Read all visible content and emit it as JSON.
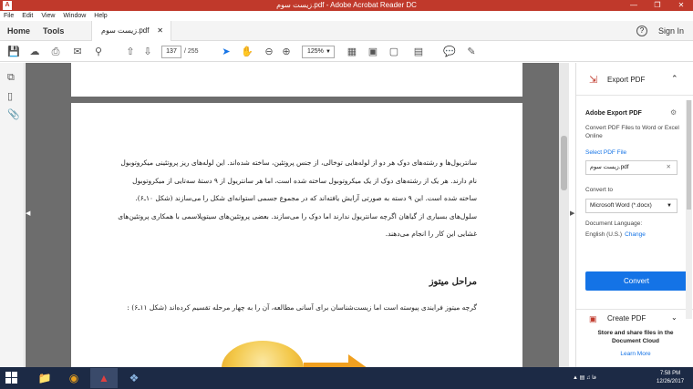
{
  "window": {
    "title": "زیست سوم.pdf - Adobe Acrobat Reader DC",
    "app_icon": "pdf-icon",
    "minimize": "—",
    "maximize": "❐",
    "close": "✕"
  },
  "menu": [
    "File",
    "Edit",
    "View",
    "Window",
    "Help"
  ],
  "tabs": {
    "home": "Home",
    "tools": "Tools",
    "doc_tab": "زیست سوم.pdf",
    "doc_tab_close": "✕",
    "help": "?",
    "sign_in": "Sign In"
  },
  "toolbar": {
    "page_current": "137",
    "page_total": "/ 255",
    "zoom": "125%",
    "icons": [
      "save-icon",
      "cloud-upload-icon",
      "print-icon",
      "email-icon",
      "search-icon",
      "prev-page-icon",
      "next-page-icon",
      "select-cursor-icon",
      "hand-icon",
      "zoom-out-icon",
      "zoom-in-icon",
      "fit-page-icon",
      "full-screen-icon",
      "rotate-icon",
      "scroll-mode-icon",
      "comment-icon",
      "sign-icon"
    ]
  },
  "document": {
    "paragraph1": "سانتریول‌ها و رشته‌های دوک هر دو از لوله‌هایی توخالی، از جنس پروتئین، ساخته شده‌اند. این لوله‌های ریز پروتئینی میکروتوبول نام دارند. هر یک از رشته‌های دوک از یک میکروتوبول ساخته شده است، اما هر سانتریول از ۹ دستهٔ سه‌تایی از میکروتوبول ساخته شده است. این ۹ دسته به صورتی آرایش یافته‌اند که در مجموع جسمی استوانه‌ای شکل را می‌سازند (شکل ۱۰ـ۶). سلول‌های بسیاری از گیاهان اگرچه سانتریول ندارند اما دوک را می‌سازند. بعضی پروتئین‌های سیتوپلاسمی با همکاری پروتئین‌های غشایی این کار را انجام می‌دهند.",
    "heading": "مراحل میتوز",
    "paragraph2": "گرچه میتوز فرایندی پیوسته است اما زیست‌شناسان برای آسانی مطالعه، آن را به چهار مرحله تقسیم کرده‌اند (شکل ۱۱ـ۶) :"
  },
  "right_panel": {
    "header_label": "Export PDF",
    "title": "Adobe Export PDF",
    "description": "Convert PDF Files to Word or Excel Online",
    "select_file_link": "Select PDF File",
    "selected_file": "زیست سوم.pdf",
    "convert_to_label": "Convert to",
    "convert_to_value": "Microsoft Word (*.docx)",
    "doc_language_label": "Document Language:",
    "doc_language_value": "English (U.S.)",
    "change_link": "Change",
    "convert_button": "Convert",
    "create_pdf_label": "Create PDF",
    "store_text": "Store and share files in the Document Cloud",
    "learn_more": "Learn More"
  },
  "taskbar": {
    "apps": [
      "file-explorer-icon",
      "chrome-icon",
      "acrobat-icon",
      "paint-icon"
    ],
    "tray_lang": "فا",
    "time": "7:58 PM",
    "date": "12/26/2017"
  },
  "colors": {
    "acrobat_red": "#c0392b",
    "accent_blue": "#1473e6",
    "viewer_gray": "#6d6d6d",
    "taskbar": "#1c2a45"
  }
}
